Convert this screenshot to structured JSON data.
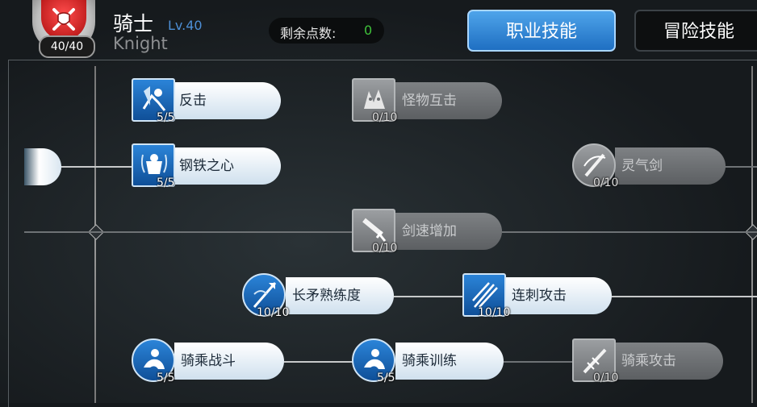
{
  "header": {
    "class_name": "骑士",
    "level": "Lv.40",
    "class_name_en": "Knight",
    "skill_points_used": "40/40",
    "remaining_label": "剩余点数:",
    "remaining_value": "0",
    "emblem_icon": "crossed-swords-shield-icon"
  },
  "tabs": [
    {
      "label": "职业技能",
      "active": true
    },
    {
      "label": "冒险技能",
      "active": false
    }
  ],
  "skills": [
    {
      "name": "反击",
      "level": "5/5",
      "unlocked": true,
      "icon": "counter-attack-icon"
    },
    {
      "name": "钢铁之心",
      "level": "5/5",
      "unlocked": true,
      "icon": "iron-heart-icon"
    },
    {
      "name": "怪物互击",
      "level": "0/10",
      "unlocked": false,
      "icon": "monster-clash-icon"
    },
    {
      "name": "灵气剑",
      "level": "0/10",
      "unlocked": false,
      "icon": "aura-sword-icon"
    },
    {
      "name": "剑速增加",
      "level": "0/10",
      "unlocked": false,
      "icon": "sword-speed-icon"
    },
    {
      "name": "长矛熟练度",
      "level": "10/10",
      "unlocked": true,
      "icon": "spear-mastery-icon"
    },
    {
      "name": "连刺攻击",
      "level": "10/10",
      "unlocked": true,
      "icon": "combo-thrust-icon"
    },
    {
      "name": "骑乘战斗",
      "level": "5/5",
      "unlocked": true,
      "icon": "mounted-combat-icon"
    },
    {
      "name": "骑乘训练",
      "level": "5/5",
      "unlocked": true,
      "icon": "riding-training-icon"
    },
    {
      "name": "骑乘攻击",
      "level": "0/10",
      "unlocked": false,
      "icon": "mounted-attack-icon"
    }
  ],
  "colors": {
    "accent_blue": "#1f6fc2",
    "level_blue": "#4d8fd6",
    "remaining_green": "#3fc13a",
    "emblem_red": "#c21f1f"
  }
}
